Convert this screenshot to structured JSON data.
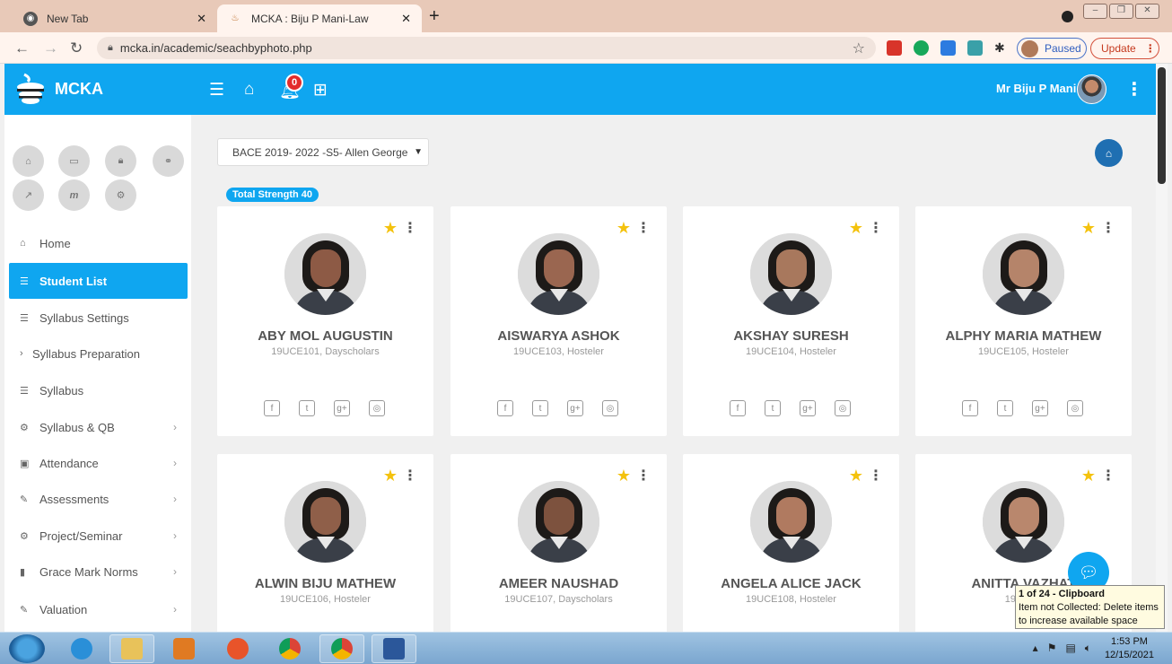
{
  "browser": {
    "tabs": [
      {
        "title": "New Tab",
        "active": false
      },
      {
        "title": "MCKA : Biju P Mani-Law",
        "active": true
      }
    ],
    "new_tab": "+",
    "url": "mcka.in/academic/seachbyphoto.php",
    "paused_label": "Paused",
    "update_label": "Update"
  },
  "header": {
    "brand": "MCKA",
    "notification_count": "0",
    "user_name": "Mr Biju P Mani"
  },
  "sidebar": {
    "items": [
      {
        "label": "Home",
        "icon": "home-icon",
        "active": false,
        "chevron": false
      },
      {
        "label": "Student List",
        "icon": "list-icon",
        "active": true,
        "chevron": false
      },
      {
        "label": "Syllabus Settings",
        "icon": "list-icon",
        "active": false,
        "chevron": false
      },
      {
        "label": "Syllabus Preparation",
        "icon": "chevron-right-icon",
        "active": false,
        "chevron": false
      },
      {
        "label": "Syllabus",
        "icon": "list-icon",
        "active": false,
        "chevron": false
      },
      {
        "label": "Syllabus & QB",
        "icon": "gears-icon",
        "active": false,
        "chevron": true
      },
      {
        "label": "Attendance",
        "icon": "calendar-check-icon",
        "active": false,
        "chevron": true
      },
      {
        "label": "Assessments",
        "icon": "pencil-icon",
        "active": false,
        "chevron": true
      },
      {
        "label": "Project/Seminar",
        "icon": "gears-icon",
        "active": false,
        "chevron": true
      },
      {
        "label": "Grace Mark Norms",
        "icon": "book-icon",
        "active": false,
        "chevron": true
      },
      {
        "label": "Valuation",
        "icon": "pencil-icon",
        "active": false,
        "chevron": true
      }
    ]
  },
  "main": {
    "class_select": "BACE 2019- 2022 -S5- Allen George",
    "strength_badge": "Total Strength 40",
    "students": [
      {
        "name": "ABY MOL AUGUSTIN",
        "info": "19UCE101, Dayscholars"
      },
      {
        "name": "AISWARYA ASHOK",
        "info": "19UCE103, Hosteler"
      },
      {
        "name": "AKSHAY SURESH",
        "info": "19UCE104, Hosteler"
      },
      {
        "name": "ALPHY MARIA MATHEW",
        "info": "19UCE105, Hosteler"
      },
      {
        "name": "ALWIN BIJU MATHEW",
        "info": "19UCE106, Hosteler"
      },
      {
        "name": "AMEER NAUSHAD",
        "info": "19UCE107, Dayscholars"
      },
      {
        "name": "ANGELA ALICE JACK",
        "info": "19UCE108, Hosteler"
      },
      {
        "name": "ANITTA VAZHAT",
        "info": "19UCE1"
      }
    ]
  },
  "clipboard_tip": {
    "title": "1 of 24 - Clipboard",
    "line1": "Item not Collected: Delete items",
    "line2": "to increase available space"
  },
  "taskbar": {
    "time": "1:53 PM",
    "date": "12/15/2021"
  },
  "colors": {
    "primary": "#0fa6f0",
    "star": "#f4c20d",
    "badge": "#e32c2c"
  }
}
